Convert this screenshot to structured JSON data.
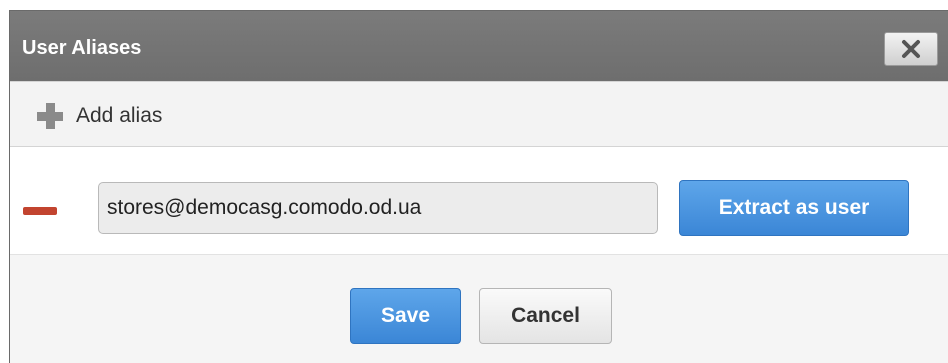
{
  "dialog": {
    "title": "User Aliases",
    "close_icon": "close-icon"
  },
  "toolbar": {
    "add_label": "Add alias",
    "add_icon": "plus-icon"
  },
  "aliases": [
    {
      "value": "stores@democasg.comodo.od.ua",
      "remove_icon": "minus-icon",
      "extract_label": "Extract as user"
    }
  ],
  "footer": {
    "save_label": "Save",
    "cancel_label": "Cancel"
  },
  "colors": {
    "titlebar": "#747474",
    "primary_button": "#4a96e0",
    "remove": "#c2442f"
  }
}
